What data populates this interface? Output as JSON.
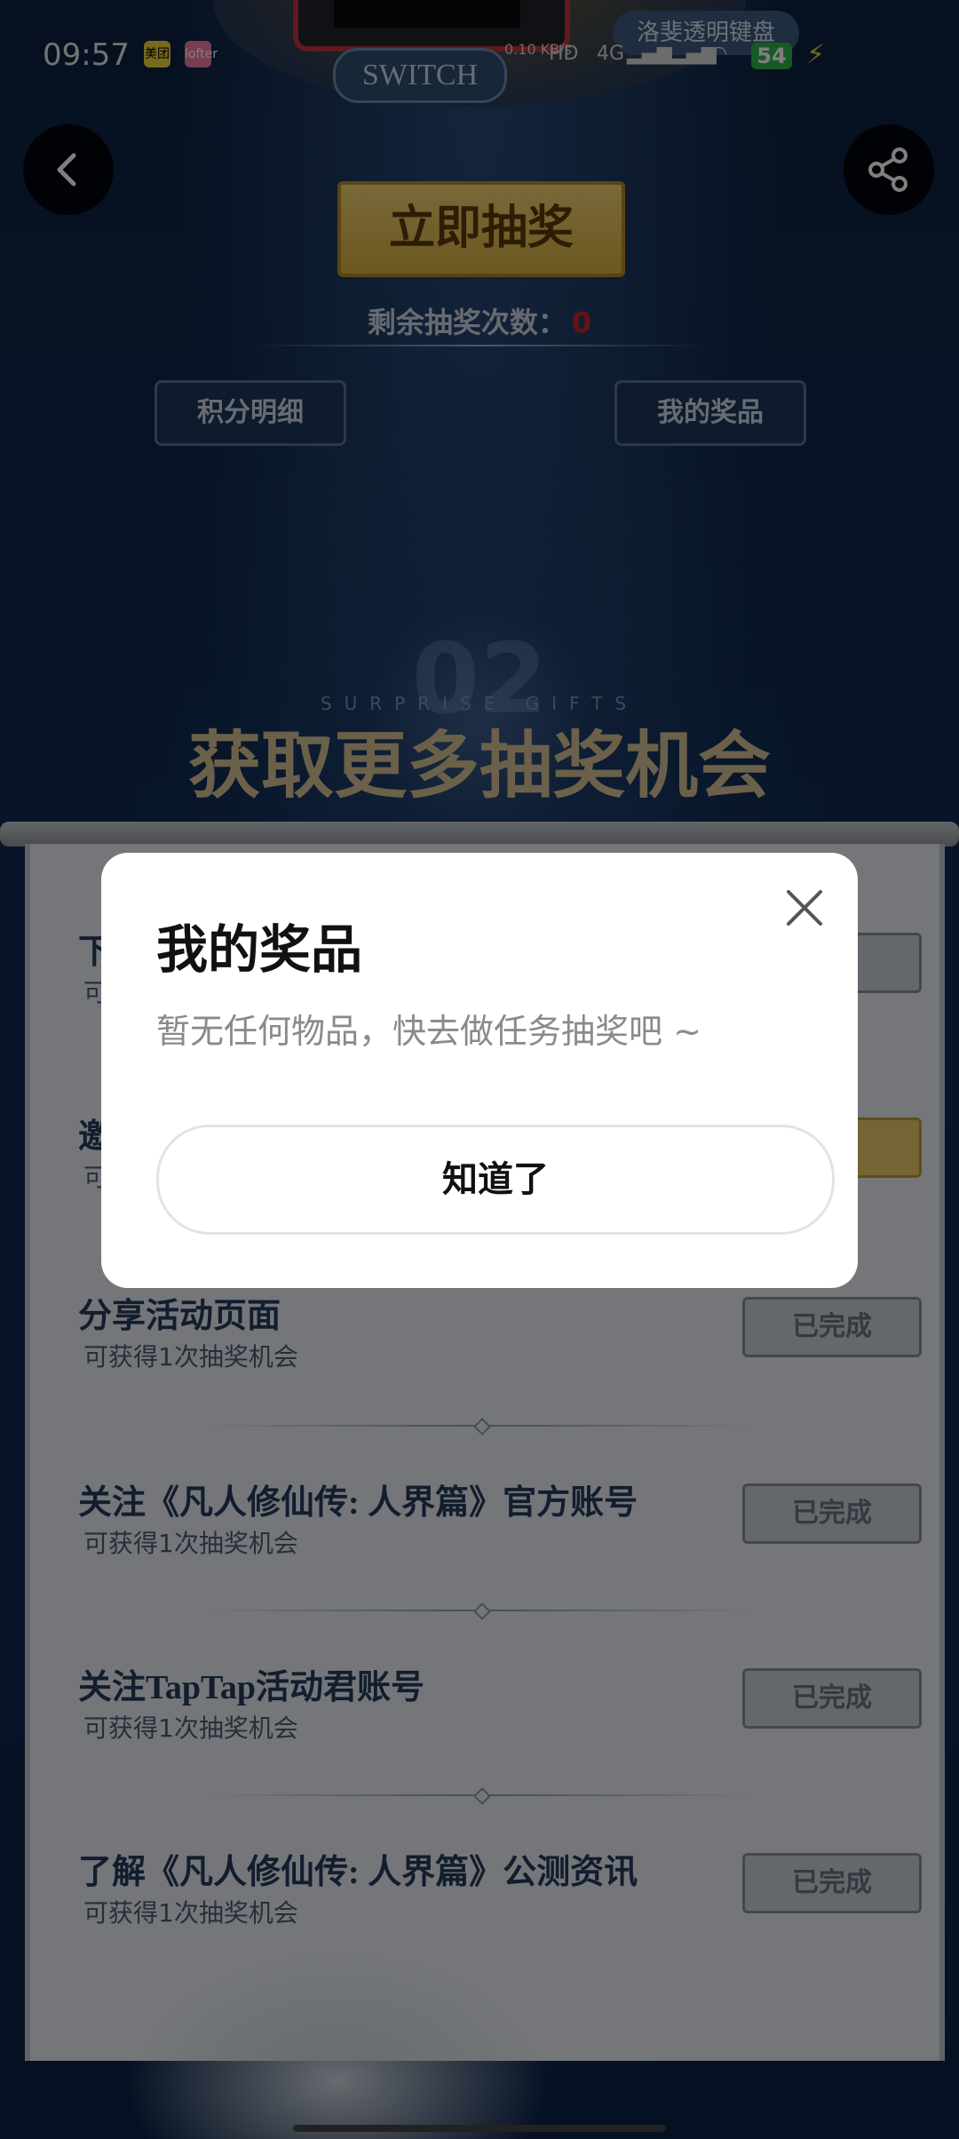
{
  "status_bar": {
    "time": "09:57",
    "app_badge_1": "美团",
    "app_badge_2": "lofter",
    "net_speed": "0.10\nKB/s",
    "hd_label": "HD",
    "network_label": "4G",
    "battery": "54"
  },
  "banner": {
    "switch_label": "SWITCH",
    "keyboard_label": "洛斐透明键盘"
  },
  "nav": {
    "back_icon": "chevron-left",
    "share_icon": "share"
  },
  "lottery": {
    "draw_label": "立即抽奖",
    "remaining_label": "剩余抽奖次数：",
    "remaining_count": "0",
    "points_detail_label": "积分明细",
    "my_prizes_label": "我的奖品"
  },
  "section": {
    "number": "02",
    "subtitle": "SURPRISE GIFTS",
    "title": "获取更多抽奖机会"
  },
  "tasks": [
    {
      "title": "下",
      "sub": "可",
      "status": ""
    },
    {
      "title": "邀",
      "sub": "可",
      "status": ""
    },
    {
      "title": "分享活动页面",
      "sub": "可获得1次抽奖机会",
      "status": "已完成"
    },
    {
      "title": "关注《凡人修仙传: 人界篇》官方账号",
      "sub": "可获得1次抽奖机会",
      "status": "已完成"
    },
    {
      "title": "关注TapTap活动君账号",
      "sub": "可获得1次抽奖机会",
      "status": "已完成"
    },
    {
      "title": "了解《凡人修仙传: 人界篇》公测资讯",
      "sub": "可获得1次抽奖机会",
      "status": "已完成"
    }
  ],
  "dialog": {
    "title": "我的奖品",
    "message": "暂无任何物品，快去做任务抽奖吧 ~",
    "confirm_label": "知道了"
  },
  "colors": {
    "accent_gold": "#d8ae3d",
    "count_red": "#d22525",
    "battery_green": "#2fb44a"
  }
}
